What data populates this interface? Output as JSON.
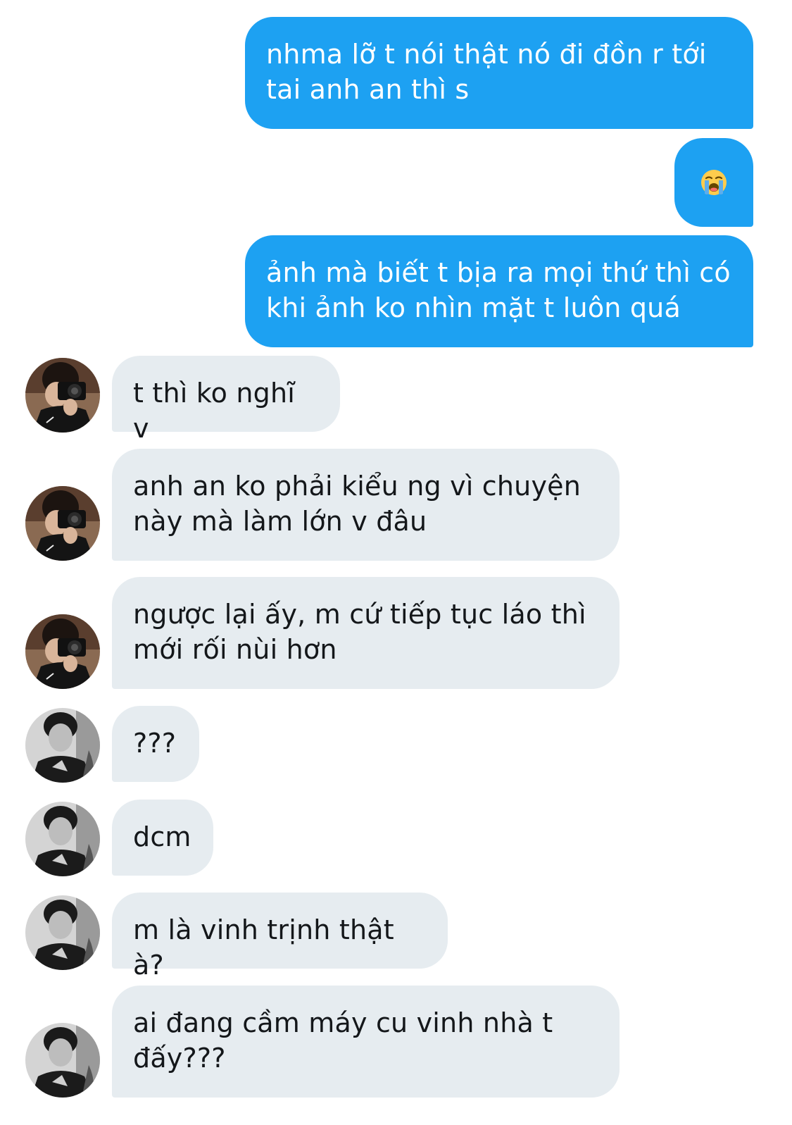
{
  "conversation": {
    "messages": [
      {
        "sender": "me",
        "text": "nhma lỡ t nói thật nó đi đồn r tới\ntai anh an thì s"
      },
      {
        "sender": "me",
        "emoji": "loudly-crying-face"
      },
      {
        "sender": "me",
        "text": "ảnh mà biết t bịa ra mọi thứ thì có\nkhi ảnh ko nhìn mặt t luôn quá"
      },
      {
        "sender": "friend-camera",
        "text": "t thì ko nghĩ v"
      },
      {
        "sender": "friend-camera",
        "text": "anh an ko phải kiểu ng vì chuyện\nnày mà làm lớn v đâu"
      },
      {
        "sender": "friend-camera",
        "text": "ngược lại ấy, m cứ tiếp tục láo thì\nmới rối nùi hơn"
      },
      {
        "sender": "friend-bw",
        "text": "???"
      },
      {
        "sender": "friend-bw",
        "text": "dcm"
      },
      {
        "sender": "friend-bw",
        "text": "m là vinh trịnh thật à?"
      },
      {
        "sender": "friend-bw",
        "text": "ai đang cầm máy cu vinh nhà t\nđấy???"
      }
    ]
  },
  "colors": {
    "outgoing_bubble": "#1da1f2",
    "incoming_bubble": "#e6ecf0",
    "incoming_text": "#14171a",
    "outgoing_text": "#ffffff"
  }
}
